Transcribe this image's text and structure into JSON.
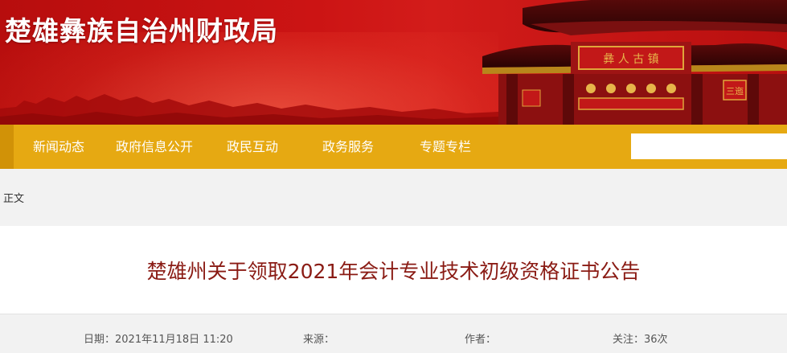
{
  "site": {
    "title": "楚雄彝族自治州财政局"
  },
  "nav": {
    "items": [
      {
        "label": "新闻动态"
      },
      {
        "label": "政府信息公开"
      },
      {
        "label": "政民互动"
      },
      {
        "label": "政务服务"
      },
      {
        "label": "专题专栏"
      }
    ],
    "search": {
      "value": "",
      "placeholder": ""
    }
  },
  "breadcrumb": {
    "current": "正文"
  },
  "article": {
    "title": "楚雄州关于领取2021年会计专业技术初级资格证书公告",
    "meta": {
      "date_label": "日期：",
      "date_value": "2021年11月18日 11:20",
      "source_label": "来源：",
      "source_value": "",
      "author_label": "作者：",
      "author_value": "",
      "views_label": "关注：",
      "views_value": "36次"
    }
  },
  "colors": {
    "banner_red": "#cc1414",
    "nav_gold": "#e6a912",
    "title_red": "#8a1b14"
  }
}
